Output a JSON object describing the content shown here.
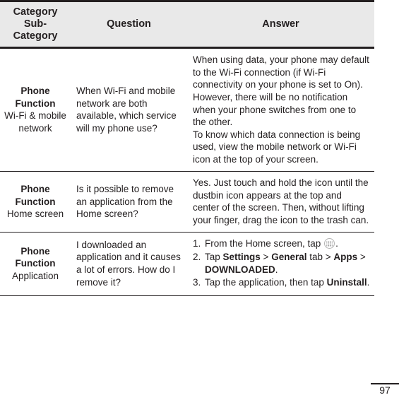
{
  "document": {
    "page_number": "97",
    "header_background": "#e9e9e9",
    "text_color": "#231f20"
  },
  "table": {
    "columns": [
      {
        "label_line1": "Category",
        "label_line2": "Sub-",
        "label_line3": "Category"
      },
      {
        "label": "Question"
      },
      {
        "label": "Answer"
      }
    ],
    "rows": [
      {
        "category_main": "Phone Function",
        "category_sub": "Wi-Fi & mobile network",
        "question": "When Wi-Fi and mobile network are both available, which service will my phone use?",
        "answer_paragraphs": [
          "When using data, your phone may default to the Wi-Fi connection (if Wi-Fi connectivity on your phone is set to On). However, there will be no notification when your phone switches from one to the other.",
          "To know which data connection is being used, view the mobile network or Wi-Fi icon at the top of your screen."
        ]
      },
      {
        "category_main": "Phone Function",
        "category_sub": "Home screen",
        "question": "Is it possible to remove an application from the Home screen?",
        "answer_paragraphs": [
          "Yes. Just touch and hold the icon until the dustbin icon appears at the top and center of the screen. Then, without lifting your finger, drag the icon to the trash can."
        ]
      },
      {
        "category_main": "Phone Function",
        "category_sub": "Application",
        "question": "I downloaded an application and it causes a lot of errors. How do I remove it?",
        "answer_steps": [
          {
            "number": "1.",
            "before_icon": "From the Home screen, tap ",
            "icon": "app-drawer-icon",
            "after_icon": "."
          },
          {
            "number": "2.",
            "segments": [
              {
                "text": "Tap ",
                "bold": false
              },
              {
                "text": "Settings",
                "bold": true
              },
              {
                "text": " > ",
                "bold": false
              },
              {
                "text": "General",
                "bold": true
              },
              {
                "text": " tab > ",
                "bold": false
              },
              {
                "text": "Apps",
                "bold": true
              },
              {
                "text": " > ",
                "bold": false
              },
              {
                "text": "DOWNLOADED",
                "bold": true
              },
              {
                "text": ".",
                "bold": false
              }
            ]
          },
          {
            "number": "3.",
            "segments": [
              {
                "text": "Tap the application, then tap ",
                "bold": false
              },
              {
                "text": "Uninstall",
                "bold": true
              },
              {
                "text": ".",
                "bold": false
              }
            ]
          }
        ]
      }
    ]
  }
}
